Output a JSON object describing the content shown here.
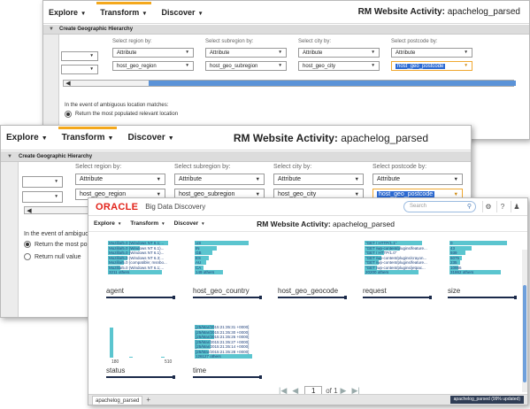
{
  "nav": {
    "explore": "Explore",
    "transform": "Transform",
    "discover": "Discover",
    "title_prefix": "RM Website Activity: ",
    "title_name": "apachelog_parsed"
  },
  "geo_panel": {
    "header": "Create Geographic Hierarchy",
    "columns": [
      {
        "label": "Select region by:",
        "type": "Attribute",
        "attr": "host_geo_region"
      },
      {
        "label": "Select subregion by:",
        "type": "Attribute",
        "attr": "host_geo_subregion"
      },
      {
        "label": "Select city by:",
        "type": "Attribute",
        "attr": "host_geo_city"
      },
      {
        "label": "Select postcode by:",
        "type": "Attribute",
        "attr": "host_geo_postcode"
      }
    ],
    "ambiguous_note": "In the event of ambiguous location matches:",
    "ambiguous_note_short": "In the event of ambiguous",
    "option_populated": "Return the most populated relevant location",
    "option_populated_short": "Return the most popula",
    "option_null": "Return null value"
  },
  "bdd": {
    "brand": "ORACLE",
    "product": "Big Data Discovery",
    "search_placeholder": "Search",
    "title_prefix": "RM Website Activity: ",
    "title_name": "apachelog_parsed",
    "tiles": {
      "agent": {
        "label": "agent",
        "values": [
          "Mozilla/5.0 (Windows NT 6.1;...",
          "Mozilla/5.0 (Windows NT 6.1)...",
          "Mozilla/5.0 (Windows NT 6.1)...",
          "Mozilla/5.0 (Windows NT 6.3;...",
          "Mozilla/5.0 (compatible; msnbo...",
          "Mozilla/5.0 (Windows NT 6.1;...",
          "3211 others"
        ],
        "bar_fraction": [
          0.95,
          0.5,
          0.35,
          0.3,
          0.25,
          0.2,
          0.85
        ]
      },
      "host_geo_country": {
        "label": "host_geo_country",
        "values": [
          "US",
          "IN",
          "GB",
          "ES",
          "AU",
          "CA",
          "149 others"
        ],
        "bar_fraction": [
          0.85,
          0.35,
          0.28,
          0.22,
          0.18,
          0.14,
          0.45
        ]
      },
      "host_geo_geocode": {
        "label": "host_geo_geocode"
      },
      "request": {
        "label": "request",
        "values": [
          "\"GET / HTTP/1.1\"",
          "\"GET /wp-content/plugins/feature...",
          "\"GET / HTTP/1.0\"",
          "\"GET /wp-content/plugins/crayon...",
          "\"GET /wp-content/plugins/feature...",
          "\"GET /wp-content/plugins/jetpac...",
          "20200 others"
        ],
        "bar_fraction": [
          0.9,
          0.55,
          0.3,
          0.26,
          0.22,
          0.2,
          0.85
        ]
      },
      "size": {
        "label": "size",
        "values": [
          "0",
          "43",
          "939",
          "6075",
          "235",
          "10986",
          "31862 others"
        ],
        "bar_fraction": [
          0.9,
          0.35,
          0.25,
          0.2,
          0.16,
          0.14,
          0.8
        ]
      },
      "status": {
        "label": "status",
        "axis_min": "180",
        "axis_max": "510",
        "bins": [
          0.95,
          0.0,
          0.0,
          0.03,
          0.0,
          0.0,
          0.0,
          0.0,
          0.04,
          0.0
        ]
      },
      "time": {
        "label": "time",
        "values": [
          "[25/Mar/2015:21:35:31 +0000]",
          "[25/Mar/2015:21:35:30 +0000]",
          "[25/Mar/2015:21:35:26 +0000]",
          "[25/Mar/2015:21:35:27 +0000]",
          "[25/Mar/2015:21:35:14 +0000]",
          "[25/Mar/2015:21:35:28 +0000]",
          "126127 others"
        ],
        "bar_fraction": [
          0.3,
          0.3,
          0.3,
          0.25,
          0.25,
          0.22,
          0.9
        ]
      }
    },
    "pager": {
      "page": "1",
      "of": "of 1"
    },
    "bottom_tab": "apachelog_parsed",
    "status_text": "apachelog_parsed (99% updated)"
  }
}
